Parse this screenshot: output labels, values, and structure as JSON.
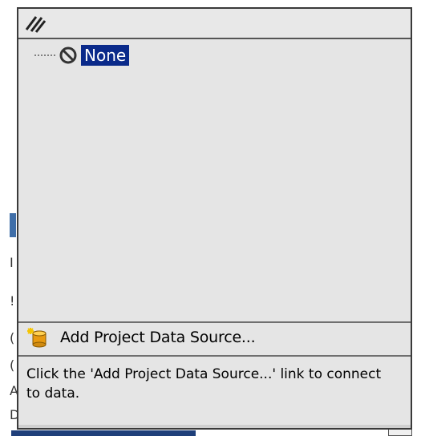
{
  "popup": {
    "tree": {
      "items": [
        {
          "label": "None",
          "icon": "none-circle-slash-icon",
          "selected": true
        }
      ]
    },
    "add_link": {
      "label": "Add Project Data Source...",
      "icon": "database-add-icon"
    },
    "help_text": "Click the 'Add Project Data Source...' link to connect to data."
  },
  "colors": {
    "selection_bg": "#0a2a8a",
    "panel_bg": "#e5e5e5",
    "border": "#3a3a3a"
  }
}
